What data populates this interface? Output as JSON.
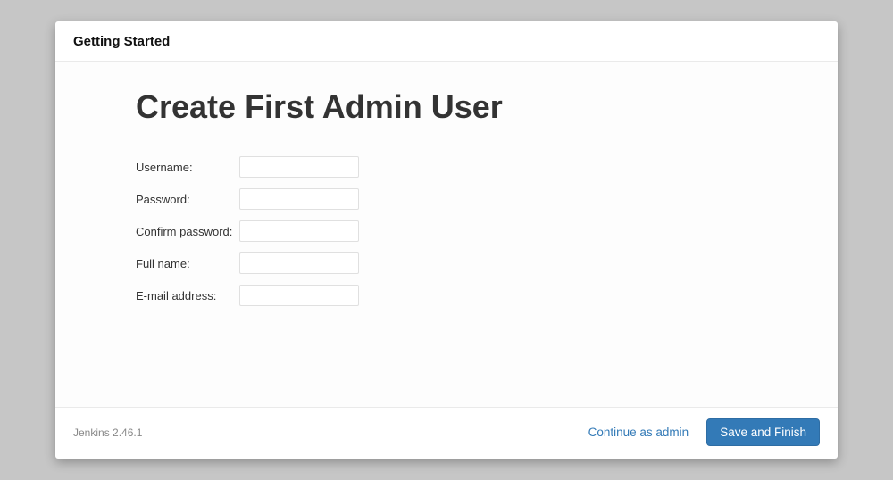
{
  "header": {
    "title": "Getting Started"
  },
  "main": {
    "heading": "Create First Admin User",
    "fields": {
      "username": {
        "label": "Username:",
        "value": ""
      },
      "password": {
        "label": "Password:",
        "value": ""
      },
      "confirm_password": {
        "label": "Confirm password:",
        "value": ""
      },
      "full_name": {
        "label": "Full name:",
        "value": ""
      },
      "email": {
        "label": "E-mail address:",
        "value": ""
      }
    }
  },
  "footer": {
    "version": "Jenkins 2.46.1",
    "continue_label": "Continue as admin",
    "save_label": "Save and Finish"
  }
}
